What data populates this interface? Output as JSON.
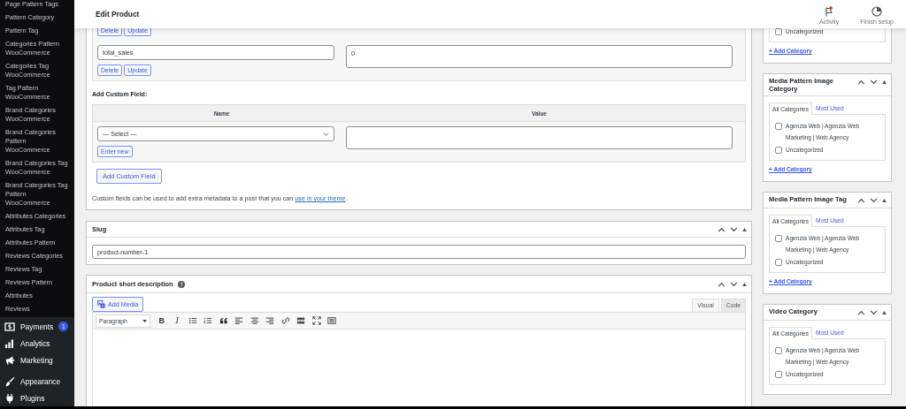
{
  "sidebar": {
    "submenu": [
      "Page Pattern Tags",
      "Pattern Category",
      "Pattern Tag",
      "Categories Pattern WooCommerce",
      "Categories Tag WooCommerce",
      "Tag Pattern WooCommerce",
      "Brand Categories WooCommerce",
      "Brand Categories Pattern WooCommerce",
      "Brand Categories Tag WooCommerce",
      "Brand Categories Tag Pattern WooCommerce",
      "Attributes Categories",
      "Attributes Tag",
      "Attributes Pattern",
      "Reviews Categories",
      "Reviews Tag",
      "Reviews Pattern",
      "Attributes",
      "Reviews"
    ],
    "menu": [
      {
        "label": "Payments",
        "kind": "payments",
        "badge": "1"
      },
      {
        "label": "Analytics",
        "kind": "analytics"
      },
      {
        "label": "Marketing",
        "kind": "marketing"
      },
      {
        "label": "Appearance",
        "kind": "appearance"
      },
      {
        "label": "Plugins",
        "kind": "plugins"
      }
    ]
  },
  "topbar": {
    "title": "Edit Product",
    "actions": [
      {
        "label": "Activity",
        "kind": "activity"
      },
      {
        "label": "Finish setup",
        "kind": "setup"
      }
    ]
  },
  "custom_fields": {
    "rows": [
      {
        "buttons": [
          "Delete",
          "Update"
        ]
      },
      {
        "name": "total_sales",
        "value": "0",
        "buttons": [
          "Delete",
          "Update"
        ]
      }
    ],
    "add_title": "Add Custom Field:",
    "columns": [
      "Name",
      "Value"
    ],
    "select": "— Select —",
    "enter_new": "Enter new",
    "add_button": "Add Custom Field",
    "note": "Custom fields can be used to add extra metadata to a post that you can ",
    "note_link": "use in your theme",
    "note_end": "."
  },
  "slug": {
    "title": "Slug",
    "value": "product-number-1"
  },
  "short_description": {
    "title": "Product short description",
    "add_media": "Add Media",
    "tabs": [
      {
        "label": "Visual",
        "selected": true
      },
      {
        "label": "Code",
        "selected": false
      }
    ],
    "format": "Paragraph",
    "toolbar": [
      {
        "kind": "bold",
        "label": "B"
      },
      {
        "kind": "italic",
        "label": "I"
      },
      {
        "kind": "bullets"
      },
      {
        "kind": "numbers"
      },
      {
        "kind": "quote"
      },
      {
        "kind": "align-left"
      },
      {
        "kind": "align-center"
      },
      {
        "kind": "align-right"
      },
      {
        "kind": "link"
      },
      {
        "kind": "more"
      },
      {
        "kind": "fullscreen"
      },
      {
        "kind": "toolbar-toggle"
      }
    ]
  },
  "category_boxes": [
    {
      "items": [
        {
          "label": "Uncategorized",
          "checked": false
        }
      ],
      "add_link": "+ Add Category"
    },
    {
      "title": "Media Pattern Image Category",
      "tabs": [
        {
          "label": "All Categories",
          "selected": true
        },
        {
          "label": "Most Used",
          "selected": false
        }
      ],
      "items": [
        {
          "label": "Agenzia Web | Agenzia Web Marketing | Web Agency",
          "checked": false
        },
        {
          "label": "Uncategorized",
          "checked": false
        }
      ],
      "add_link": "+ Add Category"
    },
    {
      "title": "Media Pattern Image Tag",
      "tabs": [
        {
          "label": "All Categories",
          "selected": true
        },
        {
          "label": "Most Used",
          "selected": false
        }
      ],
      "items": [
        {
          "label": "Agenzia Web | Agenzia Web Marketing | Web Agency",
          "checked": false
        },
        {
          "label": "Uncategorized",
          "checked": false
        }
      ],
      "add_link": "+ Add Category"
    },
    {
      "title": "Video Category",
      "tabs": [
        {
          "label": "All Categories",
          "selected": true
        },
        {
          "label": "Most Used",
          "selected": false
        }
      ],
      "items": [
        {
          "label": "Agenzia Web | Agenzia Web Marketing | Web Agency",
          "checked": false
        },
        {
          "label": "Uncategorized",
          "checked": false
        }
      ]
    }
  ]
}
